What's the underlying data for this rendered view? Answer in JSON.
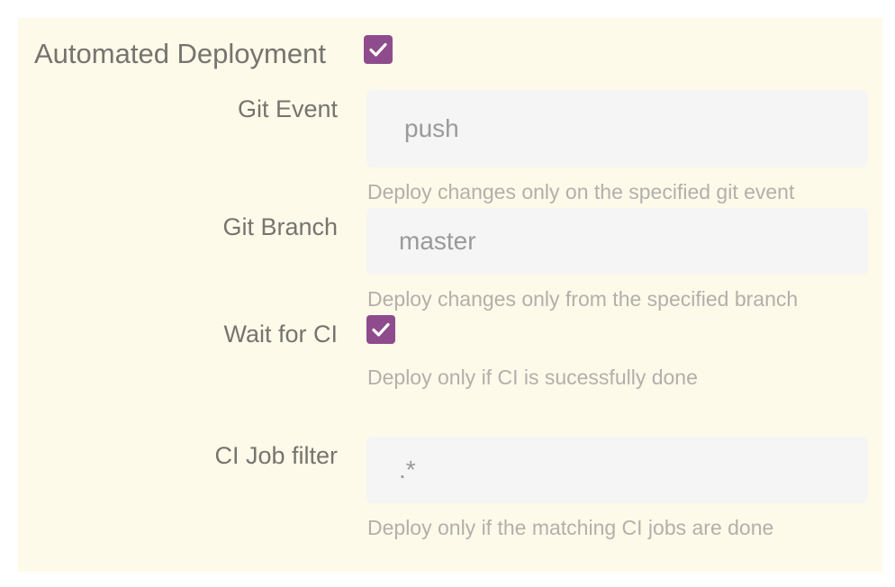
{
  "section": {
    "title": "Automated Deployment",
    "enabled": true
  },
  "fields": {
    "git_event": {
      "label": "Git Event",
      "value": "push",
      "help": "Deploy changes only on the specified git event"
    },
    "git_branch": {
      "label": "Git Branch",
      "value": "master",
      "help": "Deploy changes only from the specified branch"
    },
    "wait_for_ci": {
      "label": "Wait for CI",
      "checked": true,
      "help": "Deploy only if CI is sucessfully done"
    },
    "ci_job_filter": {
      "label": "CI Job filter",
      "value": ".*",
      "help": "Deploy only if the matching CI jobs are done"
    }
  },
  "colors": {
    "panel_background": "#fefae9",
    "checkbox_accent": "#8f4c8c",
    "input_background": "#f5f5f5"
  },
  "icons": {
    "checkbox_checked": "check-icon"
  }
}
